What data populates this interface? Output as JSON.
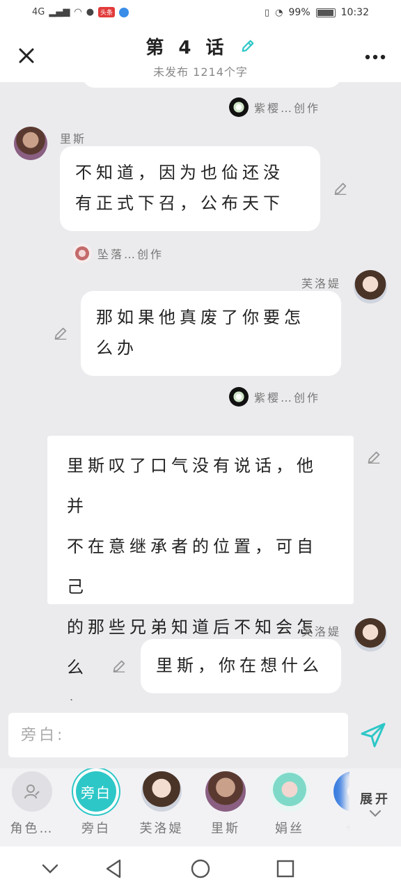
{
  "status_bar": {
    "network": "4G",
    "badge_text": "头条",
    "battery_percent": "99%",
    "time": "10:32"
  },
  "header": {
    "close_icon": "close-icon",
    "title": "第 4 话",
    "edit_icon": "pencil-icon",
    "subtitle": "未发布  1214个字",
    "more_icon": "more-icon"
  },
  "chat": {
    "messages": [
      {
        "type": "creator",
        "creator": "紫樱…创作"
      },
      {
        "type": "left",
        "name": "里斯",
        "text_lines": [
          "不知道，因为也佡还没",
          "有正式下召，公布天下"
        ],
        "creator": "坠落…创作"
      },
      {
        "type": "right",
        "name": "芙洛媞",
        "text_lines": [
          "那如果他真废了你要怎",
          "么办"
        ],
        "creator": "紫樱…创作"
      },
      {
        "type": "narration",
        "text_lines": [
          "里斯叹了口气没有说话，他并",
          "不在意继承者的位置，可自己",
          "的那些兄弟知道后不知会怎么",
          "想"
        ]
      },
      {
        "type": "right",
        "name": "芙洛媞",
        "text_lines": [
          "里斯，你在想什么"
        ]
      }
    ]
  },
  "composer": {
    "placeholder": "旁白:",
    "value": ""
  },
  "roles": {
    "items": [
      {
        "label": "角色…",
        "circle_text": ""
      },
      {
        "label": "旁白",
        "circle_text": "旁白"
      },
      {
        "label": "芙洛媞",
        "circle_text": ""
      },
      {
        "label": "里斯",
        "circle_text": ""
      },
      {
        "label": "娟丝",
        "circle_text": ""
      },
      {
        "label": "也",
        "circle_text": ""
      }
    ],
    "expand_label": "展开"
  },
  "colors": {
    "accent": "#2ec7c7",
    "background": "#ebebee",
    "bubble": "#ffffff"
  }
}
